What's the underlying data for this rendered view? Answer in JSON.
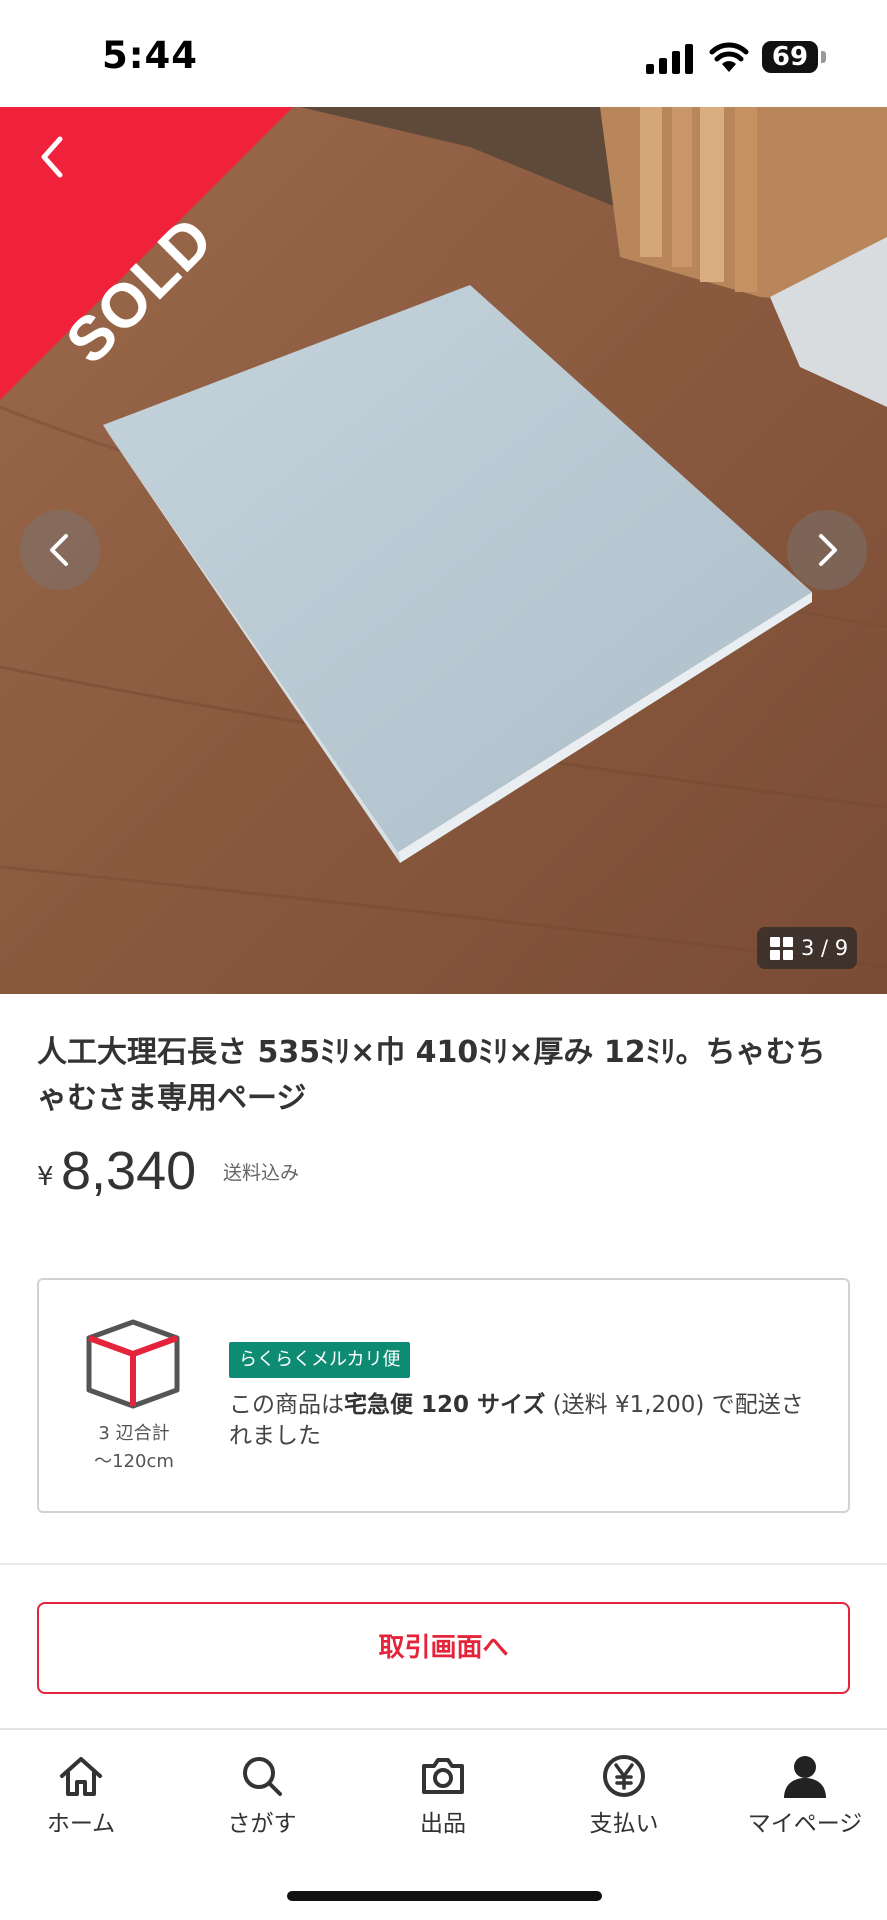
{
  "status_bar": {
    "time": "5:44",
    "battery": "69"
  },
  "hero": {
    "sold_label": "SOLD",
    "image_counter": "3 / 9",
    "image_index": 3,
    "image_total": 9,
    "sold_color": "#f0213b"
  },
  "item": {
    "title": "人工大理石長さ 535ﾐﾘ×巾 410ﾐﾘ×厚み 12ﾐﾘ。ちゃむちゃむさま専用ページ",
    "currency": "¥",
    "price": "8,340",
    "shipping_included": "送料込み"
  },
  "shipping_card": {
    "box_caption_line1": "3 辺合計",
    "box_caption_line2": "〜120cm",
    "badge": "らくらくメルカリ便",
    "desc_prefix": "この商品は",
    "desc_bold": "宅急便 120 サイズ",
    "desc_suffix": " (送料 ¥1,200) で配送されました",
    "badge_color": "#0e8c73"
  },
  "actions": {
    "trade_button": "取引画面へ",
    "accent_color": "#e3243b"
  },
  "tab_bar": {
    "items": [
      {
        "label": "ホーム",
        "icon": "home-icon"
      },
      {
        "label": "さがす",
        "icon": "search-icon"
      },
      {
        "label": "出品",
        "icon": "camera-icon"
      },
      {
        "label": "支払い",
        "icon": "yen-circle-icon"
      },
      {
        "label": "マイページ",
        "icon": "person-icon"
      }
    ]
  }
}
